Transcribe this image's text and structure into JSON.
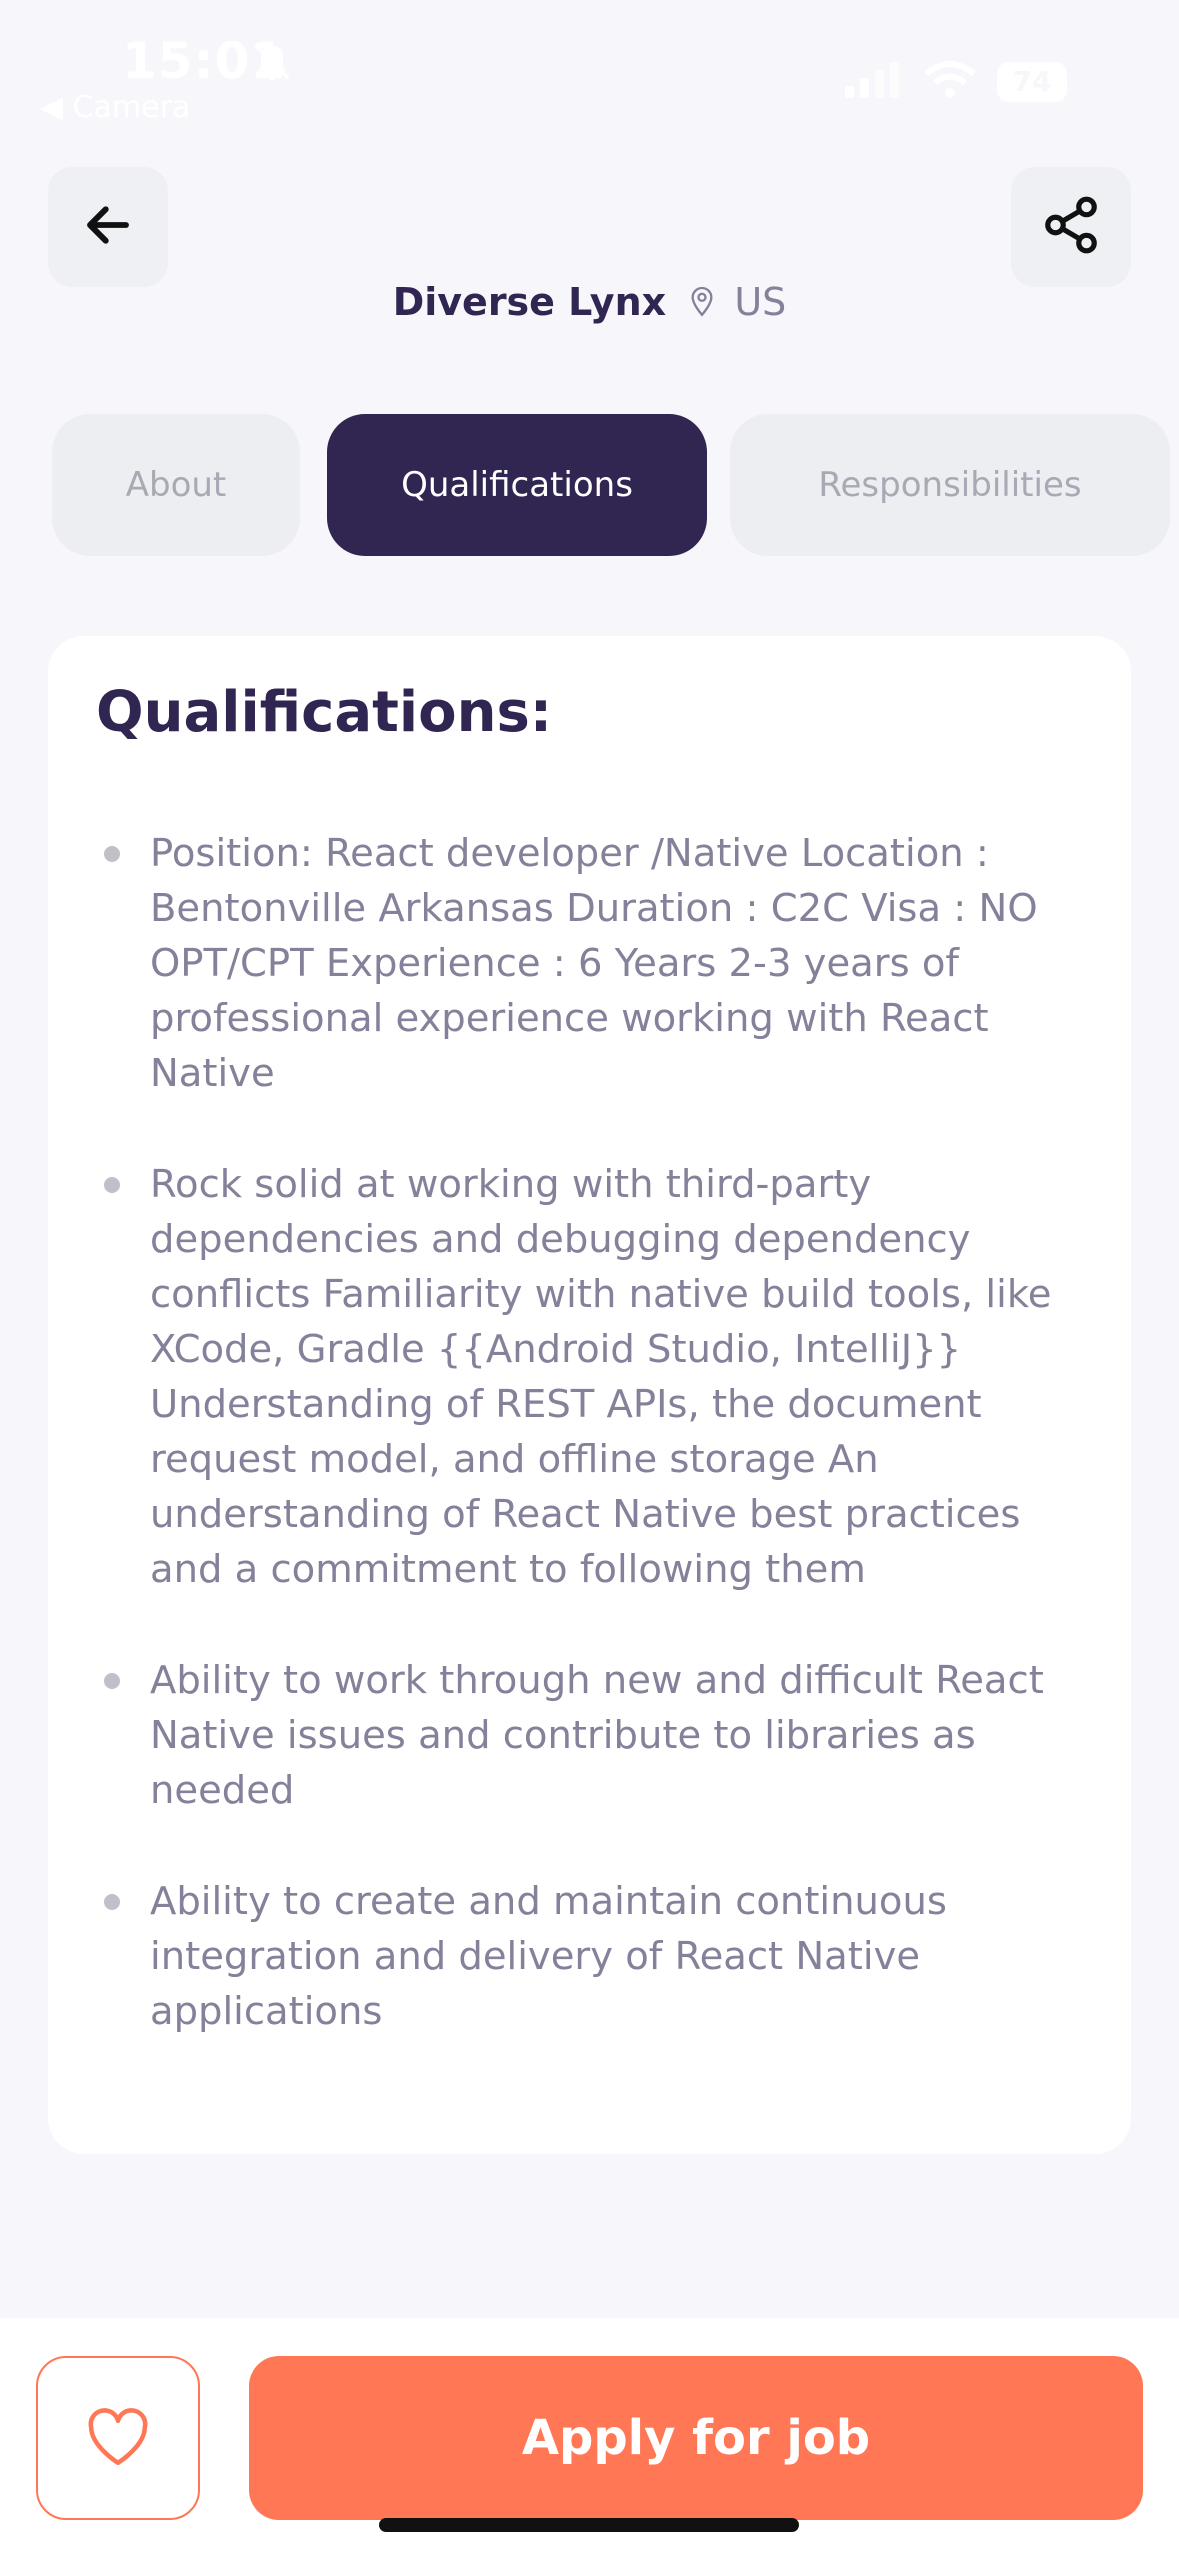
{
  "status": {
    "time": "15:01",
    "back_app": "◀ Camera",
    "battery": "74"
  },
  "job": {
    "company": "Diverse Lynx",
    "location": "US"
  },
  "tabs": [
    {
      "label": "About",
      "active": false
    },
    {
      "label": "Qualifications",
      "active": true
    },
    {
      "label": "Responsibilities",
      "active": false
    }
  ],
  "content": {
    "title": "Qualifications:",
    "points": [
      "Position: React developer /Native Location : Bentonville Arkansas Duration : C2C Visa : NO OPT/CPT Experience : 6 Years 2-3 years of professional experience working with React Native",
      "Rock solid at working with third-party dependencies and debugging dependency conflicts Familiarity with native build tools, like XCode, Gradle {{Android Studio, IntelliJ}} Understanding of REST APIs, the document request model, and offline storage An understanding of React Native best practices and a commitment to following them",
      "Ability to work through new and difficult React Native issues and contribute to libraries as needed",
      "Ability to create and maintain continuous integration and delivery of React Native applications"
    ]
  },
  "footer": {
    "apply_label": "Apply for job"
  },
  "colors": {
    "primary": "#312651",
    "accent": "#ff7754",
    "muted_text": "#83829a"
  },
  "icons": {
    "back": "arrow-left-icon",
    "share": "share-icon",
    "location": "location-pin-icon",
    "like": "heart-icon"
  }
}
